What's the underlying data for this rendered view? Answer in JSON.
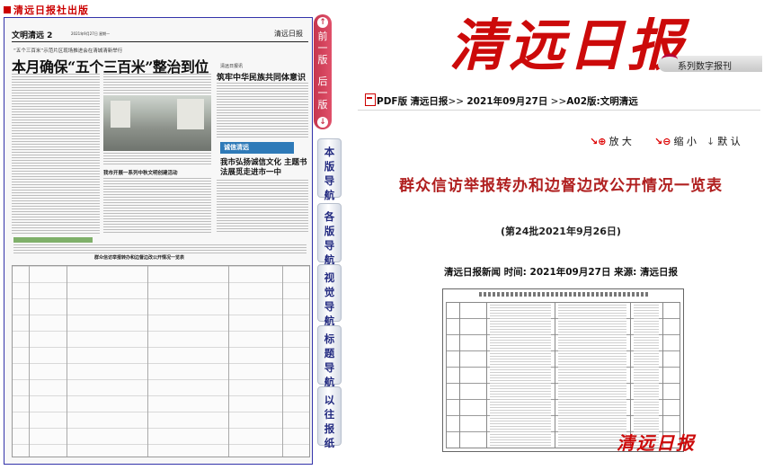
{
  "publisher": "清远日报社出版",
  "newspaper_page": {
    "section": "文明清远",
    "page_no": "2",
    "date_line": "2021年9月27日 星期一",
    "paper_logo": "清远日报",
    "subhead_1": "“五个三百米”示范片区现场推进会在清城清新举行",
    "headline_1": "本月确保“五个三百米”整治到位",
    "subhead_2": "清远日报讯",
    "headline_2": "筑牢中华民族共同体意识",
    "badge": "诚信清远",
    "headline_3": "我市弘扬诚信文化 主题书法展觅走进市一中",
    "headline_4": "我市开展一系列中秋文明创建活动",
    "table_title": "群众信访举报转办和边督边改公开情况一览表"
  },
  "page_nav": {
    "prev": "前一版",
    "next": "后一版"
  },
  "side_nav": [
    "本版导航",
    "各版导航",
    "视觉导航",
    "标题导航",
    "以往报纸"
  ],
  "masthead": "清远日报",
  "edition_label": "系列数字报刊",
  "breadcrumb": {
    "pdf": "PDF版",
    "paper": "清远日报",
    "date": "2021年09月27日",
    "page": "A02版:文明清远"
  },
  "tools": {
    "zoom_in": "放 大",
    "zoom_out": "缩 小",
    "default": "默 认"
  },
  "article": {
    "title": "群众信访举报转办和边督边改公开情况一览表",
    "subtitle": "(第24批2021年9月26日)",
    "meta": "清远日报新闻 时间: 2021年09月27日 来源: 清远日报",
    "footer_logo": "清远日报"
  },
  "colors": {
    "brand_red": "#cc0a0a",
    "nav_pink": "#c6364e",
    "nav_text": "#222a80",
    "frame_blue": "#3333aa"
  }
}
